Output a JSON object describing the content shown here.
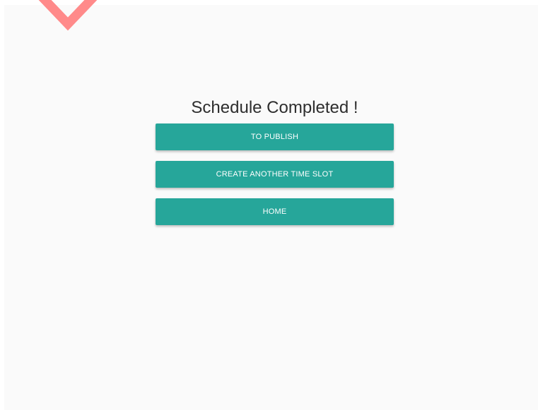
{
  "page": {
    "title": "Schedule Completed !"
  },
  "actions": {
    "publish_label": "TO PUBLISH",
    "create_label": "CREATE ANOTHER TIME SLOT",
    "home_label": "HOME"
  },
  "colors": {
    "button": "#26a69a",
    "button_text": "#ffffff",
    "panel_bg": "#fafafa",
    "chevron": "#ff8a8a"
  },
  "icons": {
    "corner_decoration": "chevron-down-icon"
  }
}
